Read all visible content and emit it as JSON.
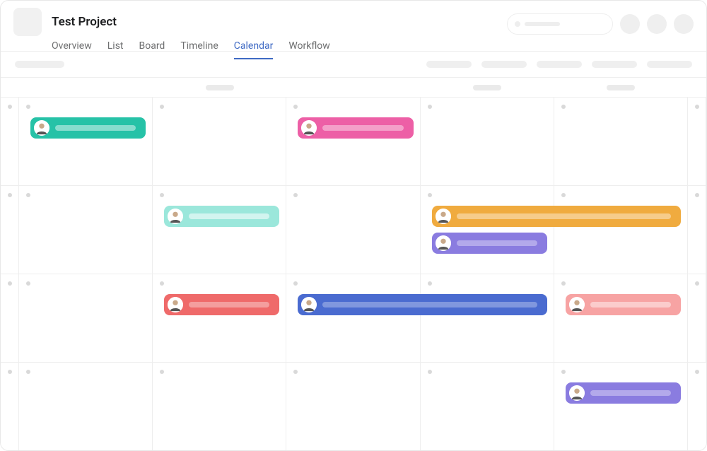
{
  "header": {
    "project_title": "Test Project",
    "tabs": [
      {
        "label": "Overview",
        "active": false
      },
      {
        "label": "List",
        "active": false
      },
      {
        "label": "Board",
        "active": false
      },
      {
        "label": "Timeline",
        "active": false
      },
      {
        "label": "Calendar",
        "active": true
      },
      {
        "label": "Workflow",
        "active": false
      }
    ]
  },
  "calendar": {
    "columns": 5,
    "rows": 4,
    "events": [
      {
        "row": 0,
        "col_start": 0,
        "col_span": 1,
        "slot": 0,
        "color": "teal",
        "assignee": "person-1"
      },
      {
        "row": 0,
        "col_start": 2,
        "col_span": 1,
        "slot": 0,
        "color": "pink",
        "assignee": "person-2"
      },
      {
        "row": 1,
        "col_start": 1,
        "col_span": 1,
        "slot": 0,
        "color": "mint",
        "assignee": "person-3"
      },
      {
        "row": 1,
        "col_start": 3,
        "col_span": 2,
        "slot": 0,
        "color": "orange",
        "assignee": "person-4"
      },
      {
        "row": 1,
        "col_start": 3,
        "col_span": 1,
        "slot": 1,
        "color": "purple",
        "assignee": "person-5"
      },
      {
        "row": 2,
        "col_start": 1,
        "col_span": 1,
        "slot": 0,
        "color": "red",
        "assignee": "person-6"
      },
      {
        "row": 2,
        "col_start": 2,
        "col_span": 2,
        "slot": 0,
        "color": "blue",
        "assignee": "person-7"
      },
      {
        "row": 2,
        "col_start": 4,
        "col_span": 1,
        "slot": 0,
        "color": "salmon",
        "assignee": "person-8"
      },
      {
        "row": 3,
        "col_start": 4,
        "col_span": 1,
        "slot": 0,
        "color": "purple",
        "assignee": "person-9"
      }
    ]
  },
  "colors": {
    "teal": "#26c2a7",
    "pink": "#ed5fa6",
    "mint": "#9be7db",
    "orange": "#f0ab3f",
    "purple": "#8a7ce0",
    "red": "#ef6a6a",
    "blue": "#4a6bd0",
    "salmon": "#f7a3a3",
    "accent": "#3f6ac4"
  }
}
